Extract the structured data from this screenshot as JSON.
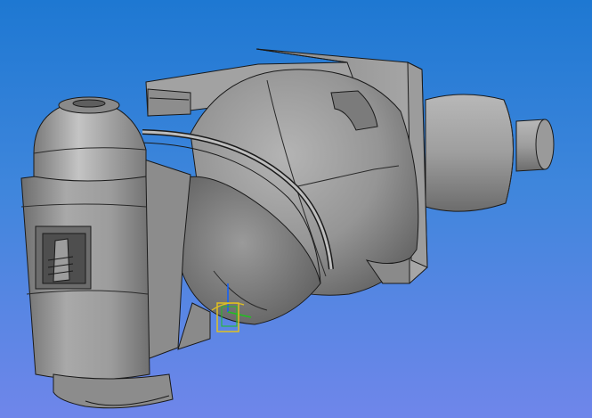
{
  "viewport": {
    "background_top": "#1e78d2",
    "background_bottom": "#6f86ea",
    "model": {
      "part_color": "#a7a7a7",
      "edge_color": "#1a1a1a"
    },
    "triad": {
      "x_color": "#e0c020",
      "y_color": "#20c020",
      "z_color": "#1060ff"
    }
  }
}
